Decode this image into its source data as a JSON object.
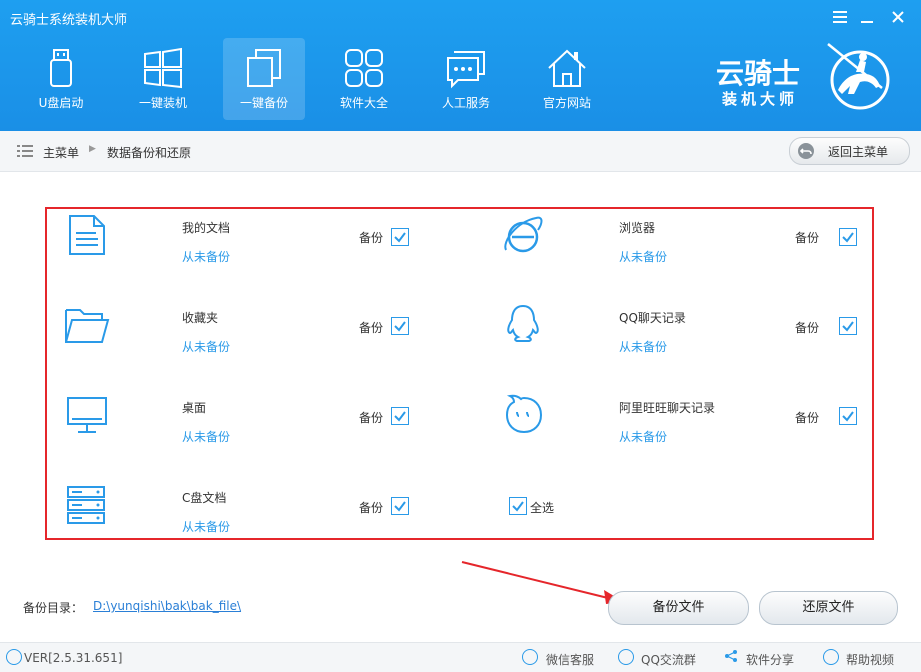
{
  "app": {
    "title": "云骑士系统装机大师"
  },
  "window_controls": {
    "menu_icon": "menu-icon",
    "minimize": "minimize-icon",
    "close": "close-icon"
  },
  "nav": {
    "items": [
      {
        "label": "U盘启动",
        "icon": "usb-icon"
      },
      {
        "label": "一键装机",
        "icon": "windows-icon"
      },
      {
        "label": "一键备份",
        "icon": "backup-icon",
        "active": true
      },
      {
        "label": "软件大全",
        "icon": "apps-icon"
      },
      {
        "label": "人工服务",
        "icon": "chat-icon"
      },
      {
        "label": "官方网站",
        "icon": "home-icon"
      }
    ]
  },
  "brand": {
    "line1": "云骑士",
    "line2": "装机大师"
  },
  "breadcrumb": {
    "root": "主菜单",
    "current": "数据备份和还原",
    "back_label": "返回主菜单"
  },
  "items": [
    {
      "name": "我的文档",
      "status": "从未备份",
      "backup_label": "备份",
      "checked": true,
      "icon": "document-icon"
    },
    {
      "name": "浏览器",
      "status": "从未备份",
      "backup_label": "备份",
      "checked": true,
      "icon": "ie-browser-icon"
    },
    {
      "name": "收藏夹",
      "status": "从未备份",
      "backup_label": "备份",
      "checked": true,
      "icon": "folder-icon"
    },
    {
      "name": "QQ聊天记录",
      "status": "从未备份",
      "backup_label": "备份",
      "checked": true,
      "icon": "qq-icon"
    },
    {
      "name": "桌面",
      "status": "从未备份",
      "backup_label": "备份",
      "checked": true,
      "icon": "monitor-icon"
    },
    {
      "name": "阿里旺旺聊天记录",
      "status": "从未备份",
      "backup_label": "备份",
      "checked": true,
      "icon": "wangwang-icon"
    },
    {
      "name": "C盘文档",
      "status": "从未备份",
      "backup_label": "备份",
      "checked": true,
      "icon": "server-icon"
    }
  ],
  "select_all": {
    "label": "全选",
    "checked": true
  },
  "backup_dir": {
    "label": "备份目录：",
    "path": "D:\\yunqishi\\bak\\bak_file\\"
  },
  "buttons": {
    "backup": "备份文件",
    "restore": "还原文件"
  },
  "footer": {
    "version": "VER[2.5.31.651]",
    "links": [
      {
        "label": "微信客服",
        "icon": "wechat-icon"
      },
      {
        "label": "QQ交流群",
        "icon": "qq-group-icon"
      },
      {
        "label": "软件分享",
        "icon": "share-icon"
      },
      {
        "label": "帮助视频",
        "icon": "help-icon"
      }
    ]
  },
  "colors": {
    "header": "#1a8fe6",
    "accent": "#2a9ae8",
    "highlight_border": "#e5262b",
    "annotation_arrow": "#e5262b"
  }
}
